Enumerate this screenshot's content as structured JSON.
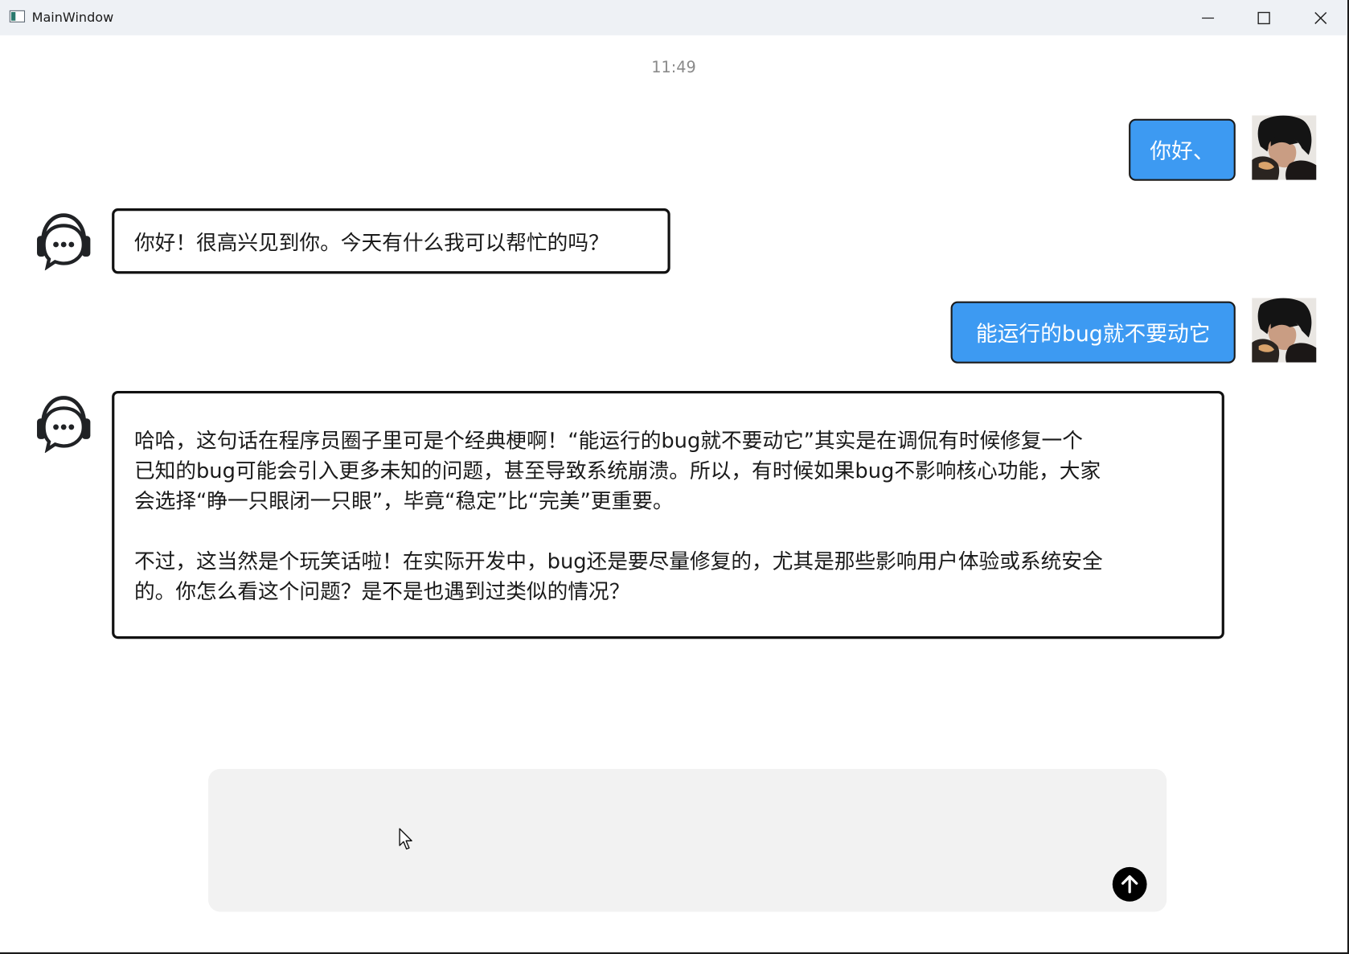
{
  "window": {
    "title": "MainWindow",
    "controls": [
      "minimize",
      "maximize",
      "close"
    ]
  },
  "chat": {
    "timestamp": "11:49",
    "messages": [
      {
        "role": "user",
        "text": "你好、"
      },
      {
        "role": "assistant",
        "lines": [
          "你好！很高兴见到你。今天有什么我可以帮忙的吗？"
        ]
      },
      {
        "role": "user",
        "text": "能运行的bug就不要动它"
      },
      {
        "role": "assistant",
        "lines": [
          "哈哈，这句话在程序员圈子里可是个经典梗啊！“能运行的bug就不要动它”其实是在调侃有时候修复一个",
          "已知的bug可能会引入更多未知的问题，甚至导致系统崩溃。所以，有时候如果bug不影响核心功能，大家",
          "会选择“睁一只眼闭一只眼”，毕竟“稳定”比“完美”更重要。",
          "",
          "不过，这当然是个玩笑话啦！在实际开发中，bug还是要尽量修复的，尤其是那些影响用户体验或系统安全",
          "的。你怎么看这个问题？是不是也遇到过类似的情况？"
        ]
      }
    ]
  },
  "composer": {
    "value": "",
    "send_icon": "arrow-up-icon"
  },
  "colors": {
    "user_bubble": "#3d9af2",
    "assistant_border": "#111111",
    "composer_bg": "#f2f2f2",
    "titlebar_bg": "#eef1f5"
  }
}
